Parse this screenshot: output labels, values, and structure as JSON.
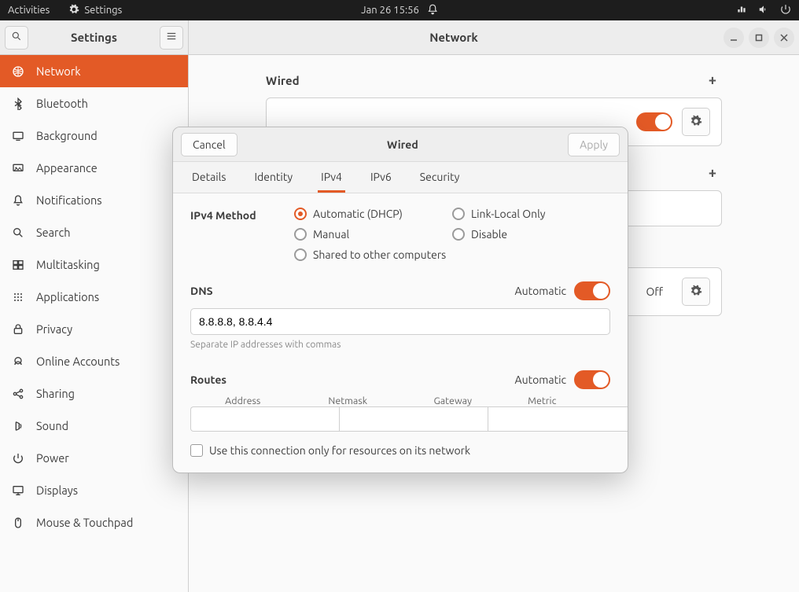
{
  "topbar": {
    "activities": "Activities",
    "app_label": "Settings",
    "clock": "Jan 26  15:56"
  },
  "window": {
    "sidebar_title": "Settings",
    "content_title": "Network"
  },
  "sidebar": {
    "items": [
      {
        "icon": "network",
        "label": "Network",
        "selected": true
      },
      {
        "icon": "bluetooth",
        "label": "Bluetooth"
      },
      {
        "icon": "background",
        "label": "Background"
      },
      {
        "icon": "appearance",
        "label": "Appearance"
      },
      {
        "icon": "notifications",
        "label": "Notifications"
      },
      {
        "icon": "search",
        "label": "Search"
      },
      {
        "icon": "multitasking",
        "label": "Multitasking"
      },
      {
        "icon": "applications",
        "label": "Applications",
        "chevron": true
      },
      {
        "icon": "privacy",
        "label": "Privacy",
        "chevron": true
      },
      {
        "icon": "online-accounts",
        "label": "Online Accounts"
      },
      {
        "icon": "sharing",
        "label": "Sharing"
      },
      {
        "icon": "sound",
        "label": "Sound"
      },
      {
        "icon": "power",
        "label": "Power"
      },
      {
        "icon": "displays",
        "label": "Displays"
      },
      {
        "icon": "mouse-touchpad",
        "label": "Mouse & Touchpad"
      }
    ]
  },
  "network_page": {
    "wired_heading": "Wired",
    "vpn_proxy_off": "Off"
  },
  "dialog": {
    "cancel": "Cancel",
    "apply": "Apply",
    "title": "Wired",
    "tabs": [
      "Details",
      "Identity",
      "IPv4",
      "IPv6",
      "Security"
    ],
    "active_tab": "IPv4",
    "ipv4": {
      "method_label": "IPv4 Method",
      "options": {
        "auto": "Automatic (DHCP)",
        "link_local": "Link-Local Only",
        "manual": "Manual",
        "disable": "Disable",
        "shared": "Shared to other computers"
      },
      "selected": "auto",
      "dns_label": "DNS",
      "dns_auto_label": "Automatic",
      "dns_value": "8.8.8.8, 8.8.4.4",
      "dns_hint": "Separate IP addresses with commas",
      "routes_label": "Routes",
      "routes_auto_label": "Automatic",
      "route_cols": {
        "address": "Address",
        "netmask": "Netmask",
        "gateway": "Gateway",
        "metric": "Metric"
      },
      "only_resources": "Use this connection only for resources on its network"
    }
  }
}
